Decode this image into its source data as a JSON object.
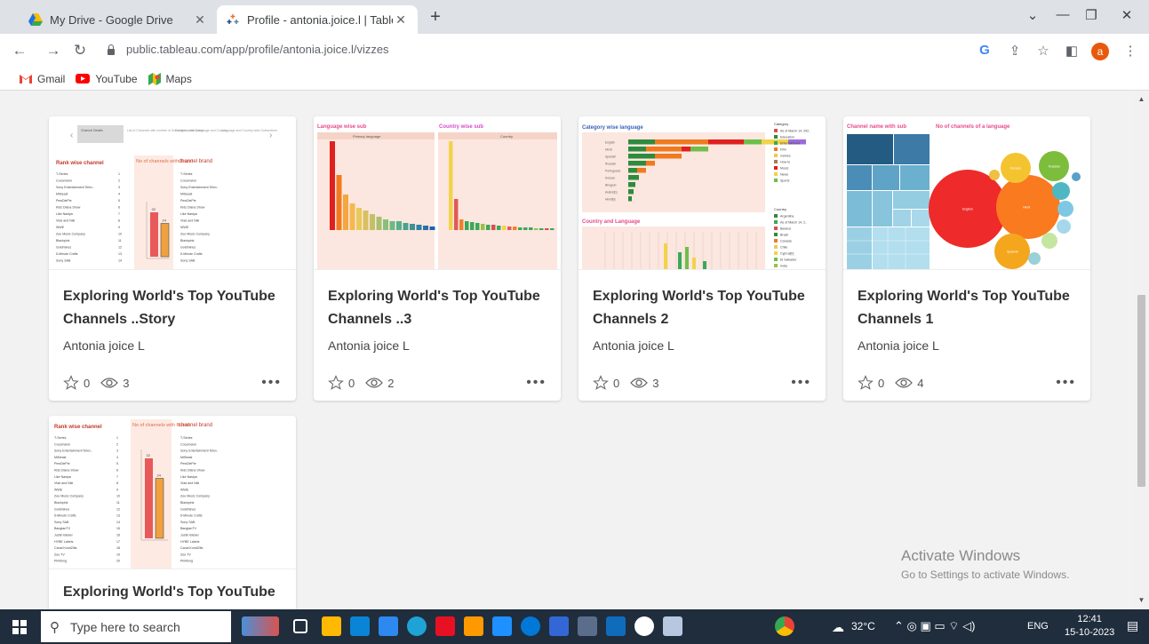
{
  "browser": {
    "tabs": [
      {
        "title": "My Drive - Google Drive",
        "icon": "google-drive-icon"
      },
      {
        "title": "Profile - antonia.joice.l | Tableau",
        "icon": "tableau-icon"
      }
    ],
    "url": "public.tableau.com/app/profile/antonia.joice.l/vizzes",
    "avatar_letter": "a",
    "bookmarks": [
      {
        "label": "Gmail",
        "icon": "gmail-icon"
      },
      {
        "label": "YouTube",
        "icon": "youtube-icon"
      },
      {
        "label": "Maps",
        "icon": "maps-icon"
      }
    ]
  },
  "vizzes": [
    {
      "title": "Exploring World's Top YouTube Channels ..Story",
      "author": "Antonia joice L",
      "favorites": "0",
      "views": "3",
      "thumb": {
        "tabs": [
          "Channel Details",
          "List of Channels with number of Subscribers with Brand",
          "Category wise Language and Country",
          "Language and Country wise Subscribers"
        ],
        "headings": [
          "Rank wise channel",
          "No of channels with Brand",
          "channel brand"
        ],
        "rows": [
          "T-Series",
          "Cocomelon",
          "Sony Entertainment Telev..",
          "MrBeast",
          "PewDiePie",
          "Kids Diana Show",
          "Like Nastya",
          "Vlad and Niki",
          "WWE",
          "Zee Music Company",
          "Blackpink",
          "Goldmines",
          "5-Minute Crafts",
          "Sony SAB"
        ],
        "bar_values": [
          32,
          24
        ]
      }
    },
    {
      "title": "Exploring World's Top YouTube Channels ..3",
      "author": "Antonia joice L",
      "favorites": "0",
      "views": "2",
      "thumb": {
        "headings": [
          "Language wise sub",
          "Country wise sub"
        ],
        "subheads": [
          "Primary language",
          "Country"
        ],
        "lang_bars": [
          1.0,
          0.62,
          0.4,
          0.3,
          0.25,
          0.22,
          0.18,
          0.15,
          0.12,
          0.1,
          0.1,
          0.08,
          0.07,
          0.06,
          0.05,
          0.04
        ],
        "country_bars": [
          1.0,
          0.35,
          0.12,
          0.1,
          0.09,
          0.08,
          0.07,
          0.06,
          0.06,
          0.05,
          0.05,
          0.04,
          0.04,
          0.03,
          0.03,
          0.03,
          0.02,
          0.02,
          0.02,
          0.02
        ]
      }
    },
    {
      "title": "Exploring World's Top YouTube Channels 2",
      "author": "Antonia joice L",
      "favorites": "0",
      "views": "3",
      "thumb": {
        "headings": [
          "Category wise language",
          "Country and Language"
        ],
        "legend_titles": [
          "Category",
          "Country"
        ],
        "categories": [
          "As of March 14, 202..",
          "Education",
          "Entertainment",
          "Film",
          "Games",
          "How to",
          "Music",
          "News",
          "Sports"
        ],
        "countries": [
          "Argentina",
          "As of March 14, 2..",
          "Belarus",
          "Brazil",
          "Canada",
          "Chile",
          "Cyprus[b]",
          "El Salvador",
          "India"
        ],
        "languages": [
          "English",
          "Hindi",
          "Spanish",
          "Russian",
          "Portuguese",
          "Korean",
          "Bhojpuri",
          "Arabic[b]",
          "Hindi[b]"
        ]
      }
    },
    {
      "title": "Exploring World's Top YouTube Channels 1",
      "author": "Antonia joice L",
      "favorites": "0",
      "views": "4",
      "thumb": {
        "headings": [
          "Channel name with sub",
          "No of channels of a language"
        ],
        "bubbles": [
          "English",
          "Hindi",
          "Spanish",
          "Korean",
          "Russian"
        ]
      }
    },
    {
      "title": "Exploring World's Top YouTube",
      "author": "",
      "favorites": "",
      "views": "",
      "thumb": {
        "headings": [
          "Rank wise channel",
          "No of channels with Brand",
          "channel brand"
        ],
        "rows": [
          "T-Series",
          "Cocomelon",
          "Sony Entertainment Telev..",
          "MrBeast",
          "PewDiePie",
          "Kids Diana Show",
          "Like Nastya",
          "Vlad and Niki",
          "WWE",
          "Zee Music Company",
          "Blackpink",
          "Goldmines",
          "5-Minute Crafts",
          "Sony SAB",
          "BangtanTV",
          "Justin Bieber",
          "HYBE Labels",
          "Canal KondZilla",
          "Zee TV",
          "Pinkfong"
        ],
        "bar_values": [
          32,
          24
        ]
      }
    }
  ],
  "watermark": {
    "line1": "Activate Windows",
    "line2": "Go to Settings to activate Windows."
  },
  "taskbar": {
    "search_placeholder": "Type here to search",
    "weather": "32°C",
    "language": "ENG",
    "time": "12:41",
    "date": "15-10-2023"
  }
}
